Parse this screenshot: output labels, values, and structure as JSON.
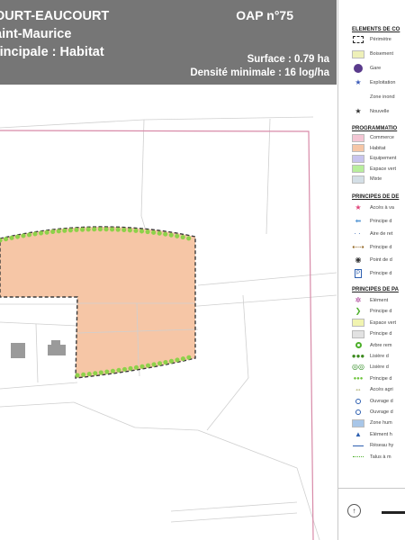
{
  "header": {
    "commune": "OURT-EAUCOURT",
    "site": "aint-Maurice",
    "vocation": "rincipale : Habitat",
    "oap_number": "OAP n°75",
    "surface": "Surface : 0.79 ha",
    "density": "Densité minimale : 16 log/ha"
  },
  "legend": {
    "sections": {
      "elements": "ELEMENTS DE CO",
      "programmation": "PROGRAMMATIO",
      "principes_desserte": "PRINCIPES DE DE",
      "principes_paysage": "PRINCIPES DE PA"
    },
    "elements": [
      {
        "label": "Périmètre",
        "icon": "dashed-square-icon"
      },
      {
        "label": "Boisement",
        "icon": "swatch-icon",
        "color": "#eef0b8"
      },
      {
        "label": "Gare",
        "icon": "train-icon",
        "color": "#5a3b8c"
      },
      {
        "label": "Exploitation",
        "icon": "star-icon",
        "color": "#3a5ab8"
      },
      {
        "label": "Zone inond",
        "icon": "blank-icon"
      },
      {
        "label": "Nouvelle",
        "icon": "star-icon",
        "color": "#333333"
      }
    ],
    "programmation": [
      {
        "label": "Commerce",
        "color": "#f4c6d4"
      },
      {
        "label": "Habitat",
        "color": "#f6c6a6"
      },
      {
        "label": "Equipement",
        "color": "#c8c4ee"
      },
      {
        "label": "Espace vert",
        "color": "#b8ee9c"
      },
      {
        "label": "Mixte",
        "color": "#d4dfe6"
      }
    ],
    "desserte": [
      {
        "label": "Accès à va",
        "icon": "pink-star-icon"
      },
      {
        "label": "Principe d",
        "icon": "blue-arrow-icon"
      },
      {
        "label": "Aire de ret",
        "icon": "dotted-line-icon"
      },
      {
        "label": "Principe d",
        "icon": "double-arrow-icon"
      },
      {
        "label": "Point de d",
        "icon": "target-icon"
      },
      {
        "label": "Principe d",
        "icon": "parking-icon"
      }
    ],
    "paysage": [
      {
        "label": "Elément",
        "icon": "flower-icon"
      },
      {
        "label": "Principe d",
        "icon": "chevron-icon"
      },
      {
        "label": "Espace vert",
        "icon": "swatch-icon",
        "color": "#f1f4b0"
      },
      {
        "label": "Principe d",
        "icon": "swatch-icon",
        "color": "#e2e2e2"
      },
      {
        "label": "Arbre rem",
        "icon": "ring-icon"
      },
      {
        "label": "Lisière d",
        "icon": "tree-row-icon"
      },
      {
        "label": "Lisière d",
        "icon": "double-ring-icon"
      },
      {
        "label": "Principe d",
        "icon": "dot-row-icon"
      },
      {
        "label": "Accès agri",
        "icon": "double-arrow-olive-icon"
      },
      {
        "label": "Ouvrage d",
        "icon": "blue-circle-icon"
      },
      {
        "label": "Ouvrage d",
        "icon": "blue-circle-icon"
      },
      {
        "label": "Zone hum",
        "icon": "swatch-icon",
        "color": "#a8c6e8"
      },
      {
        "label": "Elément h",
        "icon": "triangle-icon"
      },
      {
        "label": "Réseau hy",
        "icon": "line-icon"
      },
      {
        "label": "Talus à m",
        "icon": "dotted-green-icon"
      }
    ]
  },
  "map": {
    "perimeter_color": "#d88aa8",
    "plot_fill": "#f6c6a6",
    "hedge_color": "#8ed14a",
    "boundary_color": "#3a3a3a",
    "building_color": "#9a9a9a"
  }
}
